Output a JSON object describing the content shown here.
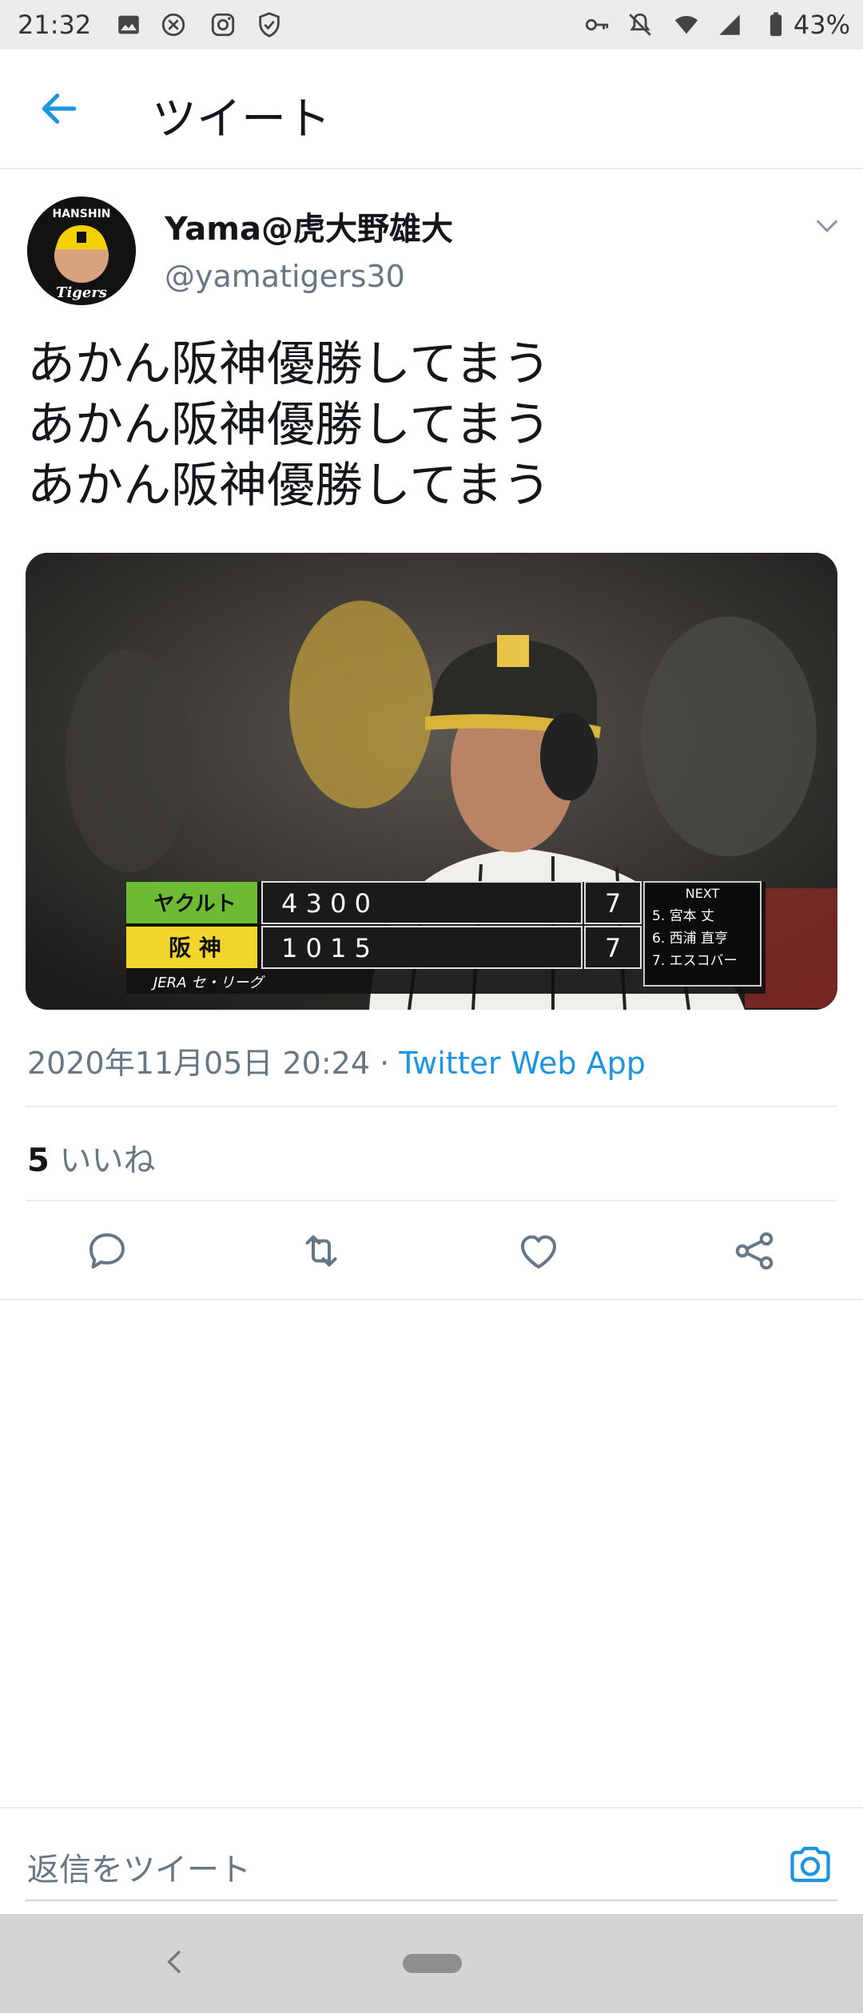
{
  "status_bar": {
    "time": "21:32",
    "battery": "43%"
  },
  "app_bar": {
    "title": "ツイート"
  },
  "tweet": {
    "author_name": "Yama@虎大野雄大",
    "author_handle": "@yamatigers30",
    "lines": [
      "あかん阪神優勝してまう",
      "あかん阪神優勝してまう",
      "あかん阪神優勝してまう"
    ],
    "timestamp": "2020年11月05日 20:24 · ",
    "source": "Twitter Web App",
    "likes_count": "5",
    "likes_label": " いいね"
  },
  "media": {
    "avatar_top_text": "HANSHIN",
    "avatar_bottom_text": "Tigers",
    "scoreboard": {
      "team1": "ヤクルト",
      "team1_runs": "4 3 0 0",
      "team1_total": "7",
      "team2": "阪 神",
      "team2_runs": "1 0 1 5",
      "team2_total": "7",
      "sponsor": "JERA セ・リーグ",
      "next_label": "NEXT",
      "next_batters": [
        "5. 宮本 丈",
        "6. 西浦 直亨",
        "7. エスコバー"
      ]
    }
  },
  "reply": {
    "placeholder": "返信をツイート"
  },
  "colors": {
    "accent": "#1b95e0",
    "secondary_text": "#657786",
    "primary_text": "#14171a"
  },
  "icons": [
    "back-arrow-icon",
    "chevron-down-icon",
    "reply-icon",
    "retweet-icon",
    "like-icon",
    "share-icon",
    "camera-icon"
  ]
}
